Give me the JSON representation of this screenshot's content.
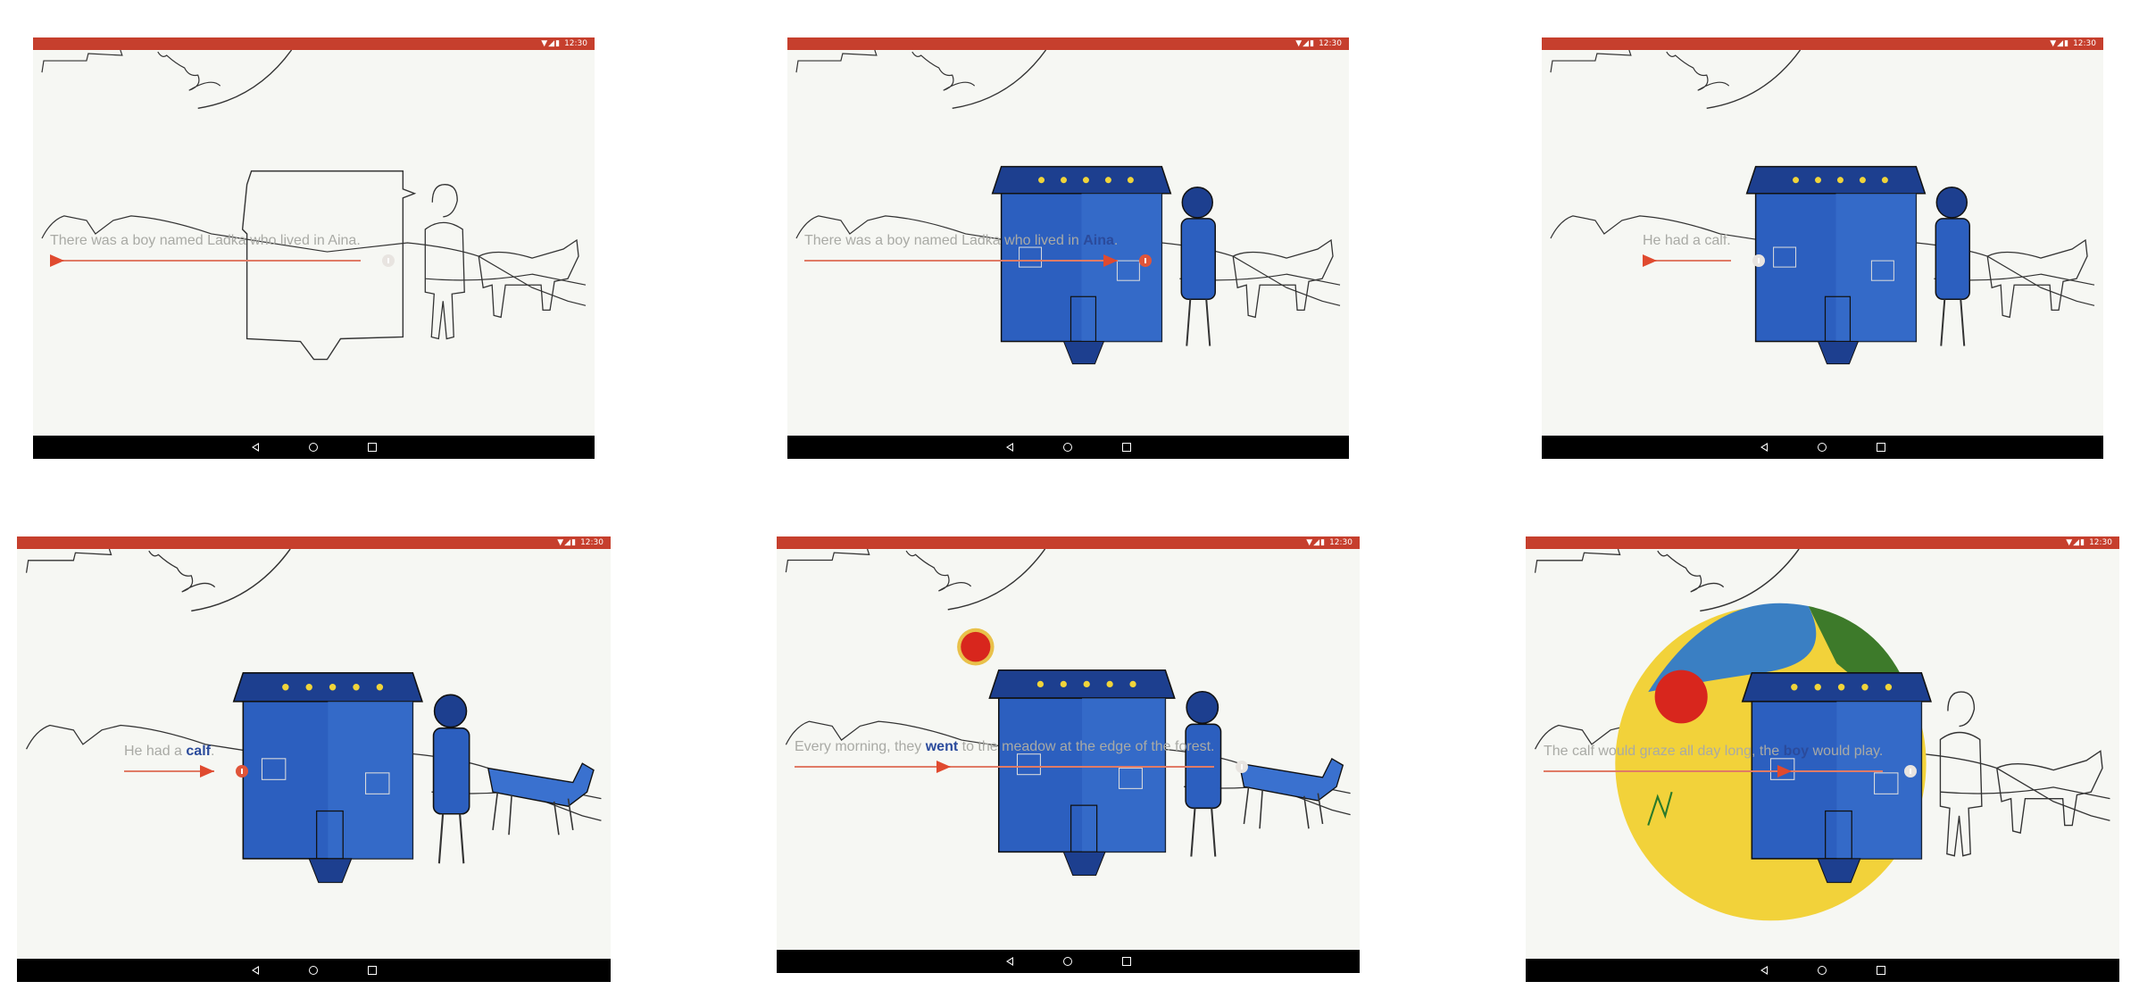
{
  "status_time": "12:30",
  "colors": {
    "status_bar": "#c63f2d",
    "nav_bar": "#000000",
    "highlight_text": "#2b4b9c",
    "caption_text": "#a9aaa5",
    "progress_arrow": "#e04a2f"
  },
  "screens": [
    {
      "caption": [
        "There was a boy named Ladka who lived in Aina.",
        "",
        ""
      ],
      "progress": 0.0,
      "audio_on": false,
      "house_colored": false,
      "calf_colored": false,
      "sun": false,
      "circle_bg": false
    },
    {
      "caption": [
        "There was a boy named Ladka who lived in ",
        "Aina",
        "."
      ],
      "progress": 1.0,
      "audio_on": true,
      "house_colored": true,
      "calf_colored": false,
      "sun": false,
      "circle_bg": false
    },
    {
      "caption": [
        "He had a calf.",
        "",
        ""
      ],
      "progress": 0.0,
      "audio_on": false,
      "house_colored": true,
      "calf_colored": false,
      "sun": false,
      "circle_bg": false
    },
    {
      "caption": [
        "He had a ",
        "calf",
        "."
      ],
      "progress": 1.0,
      "audio_on": true,
      "house_colored": true,
      "calf_colored": true,
      "sun": false,
      "circle_bg": false
    },
    {
      "caption": [
        "Every morning, they ",
        "went",
        " to the meadow at the edge of the forest."
      ],
      "progress": 0.35,
      "audio_on": false,
      "house_colored": true,
      "calf_colored": true,
      "sun": true,
      "circle_bg": false
    },
    {
      "caption": [
        "The calf would graze all day long, the ",
        "boy",
        " would play."
      ],
      "progress": 0.72,
      "audio_on": false,
      "house_colored": true,
      "calf_colored": false,
      "sun": false,
      "circle_bg": true
    }
  ]
}
